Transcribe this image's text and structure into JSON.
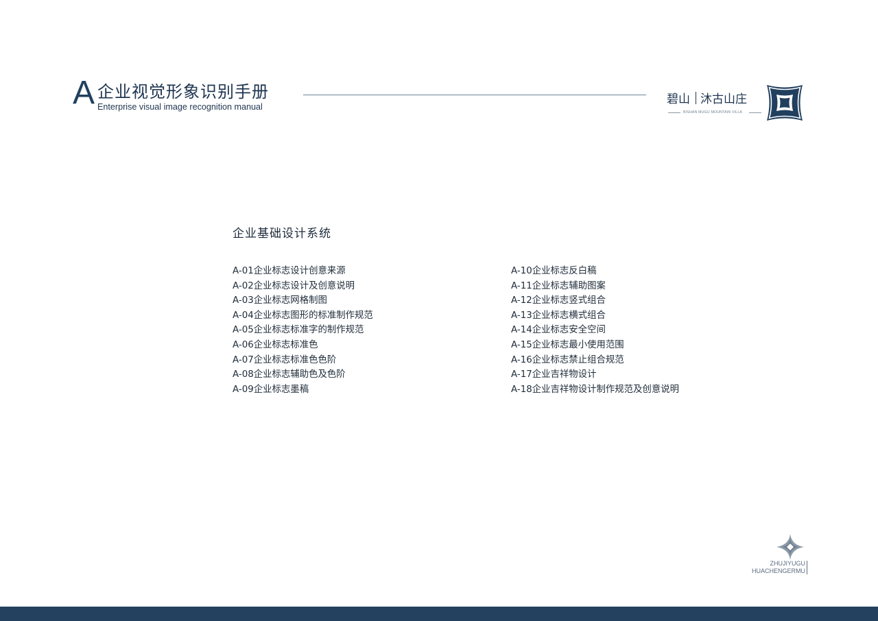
{
  "header": {
    "letter": "A",
    "title_cn": "企业视觉形象识别手册",
    "title_en": "Enterprise visual image recognition manual"
  },
  "brand": {
    "name_a": "碧山",
    "name_b": "沐古山庄",
    "subtitle": "BISHAN MUGU MOUNTAIN VILLA",
    "logo_icon": "square-emblem-icon",
    "color": "#21405f"
  },
  "section": {
    "title": "企业基础设计系统"
  },
  "toc": {
    "left": [
      "A-01企业标志设计创意来源",
      "A-02企业标志设计及创意说明",
      "A-03企业标志网格制图",
      "A-04企业标志图形的标准制作规范",
      "A-05企业标志标准字的制作规范",
      "A-06企业标志标准色",
      "A-07企业标志标准色色阶",
      "A-08企业标志辅助色及色阶",
      "A-09企业标志墨稿"
    ],
    "right": [
      "A-10企业标志反白稿",
      "A-11企业标志辅助图案",
      "A-12企业标志竖式组合",
      "A-13企业标志横式组合",
      "A-14企业标志安全空间",
      "A-15企业标志最小使用范围",
      "A-16企业标志禁止组合规范",
      "A-17企业吉祥物设计",
      "A-18企业吉祥物设计制作规范及创意说明"
    ]
  },
  "designer": {
    "icon": "four-point-star-icon",
    "line1": "ZHUJIYUGU",
    "line2": "HUACHENGERMU"
  },
  "colors": {
    "accent": "#24425f",
    "text": "#1f2c3a"
  }
}
